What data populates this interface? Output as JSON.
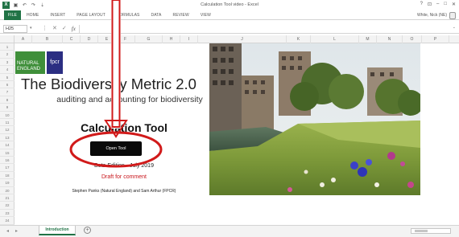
{
  "window": {
    "title": "Calculation Tool video - Excel",
    "controls": [
      "?",
      "⊡",
      "–",
      "□",
      "✕"
    ]
  },
  "quick_access": [
    "save",
    "undo",
    "redo",
    "more"
  ],
  "ribbon": {
    "tabs": [
      "FILE",
      "HOME",
      "INSERT",
      "PAGE LAYOUT",
      "FORMULAS",
      "DATA",
      "REVIEW",
      "VIEW"
    ],
    "user": "White, Nick (NE)"
  },
  "formula_bar": {
    "name_box": "H25",
    "value": ""
  },
  "columns": [
    "A",
    "B",
    "C",
    "D",
    "E",
    "F",
    "G",
    "H",
    "I",
    "J",
    "K",
    "L",
    "M",
    "N",
    "O",
    "P"
  ],
  "rows": [
    "1",
    "2",
    "3",
    "4",
    "5",
    "6",
    "7",
    "8",
    "9",
    "10",
    "11",
    "12",
    "13",
    "14",
    "15",
    "16",
    "17",
    "18",
    "19",
    "20",
    "21",
    "22",
    "23",
    "24"
  ],
  "sheet": {
    "logo_natural_england": "NATURAL ENGLAND",
    "logo_fpcr": "fpcr",
    "main_title": "The Biodiversity Metric 2.0",
    "subtitle": "auditing and accounting for biodiversity",
    "calc_title": "Calculation Tool",
    "open_tool_button": "Open Tool",
    "edition": "Beta Edition - July 2019",
    "draft": "Draft for comment",
    "authors": "Stephen Panks (Natural England) and Sam Arthur (FPCR)"
  },
  "sheet_tabs": {
    "active": "Introduction"
  },
  "colors": {
    "excel_green": "#217346",
    "annotation_red": "#d11a1a",
    "draft_red": "#c8151b",
    "fpcr_blue": "#2b2e82",
    "ne_green": "#3f8f3a"
  },
  "icons": [
    "excel-logo-icon",
    "save-icon",
    "undo-icon",
    "redo-icon",
    "help-icon",
    "ribbon-display-icon",
    "minimize-icon",
    "maximize-icon",
    "close-icon",
    "cancel-icon",
    "enter-icon",
    "function-icon",
    "add-sheet-icon"
  ]
}
